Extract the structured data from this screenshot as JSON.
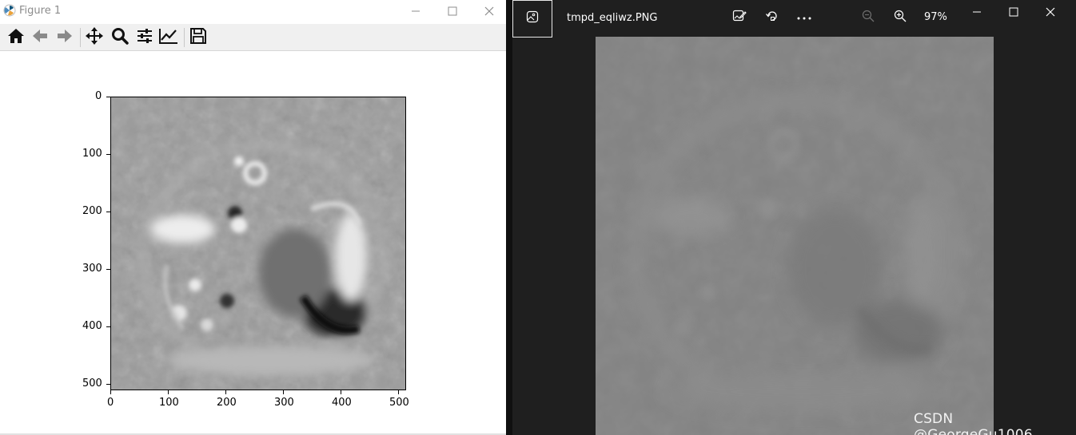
{
  "figure_window": {
    "title": "Figure 1",
    "logo_icon": "matplotlib-logo-icon",
    "toolbar": [
      {
        "name": "home-icon"
      },
      {
        "name": "back-arrow-icon"
      },
      {
        "name": "forward-arrow-icon"
      },
      {
        "name": "pan-move-icon"
      },
      {
        "name": "zoom-magnifier-icon"
      },
      {
        "name": "configure-subplots-icon"
      },
      {
        "name": "edit-axis-icon"
      },
      {
        "name": "save-icon"
      }
    ],
    "plot": {
      "content": "grayscale image",
      "y_ticks": [
        "0",
        "100",
        "200",
        "300",
        "400",
        "500"
      ],
      "x_ticks": [
        "0",
        "100",
        "200",
        "300",
        "400",
        "500"
      ]
    }
  },
  "viewer_window": {
    "filename": "tmpd_eqliwz.PNG",
    "zoom": "97%",
    "toolbar_icons": [
      "edit-image-icon",
      "rotate-icon",
      "more-icon",
      "zoom-out-icon",
      "zoom-in-icon"
    ],
    "watermark": "CSDN @GeorgeGu1006"
  },
  "colors": {
    "toolbar_bg": "#f0f0f0",
    "viewer_bg": "#1f1f1f",
    "divider": "#101010"
  }
}
